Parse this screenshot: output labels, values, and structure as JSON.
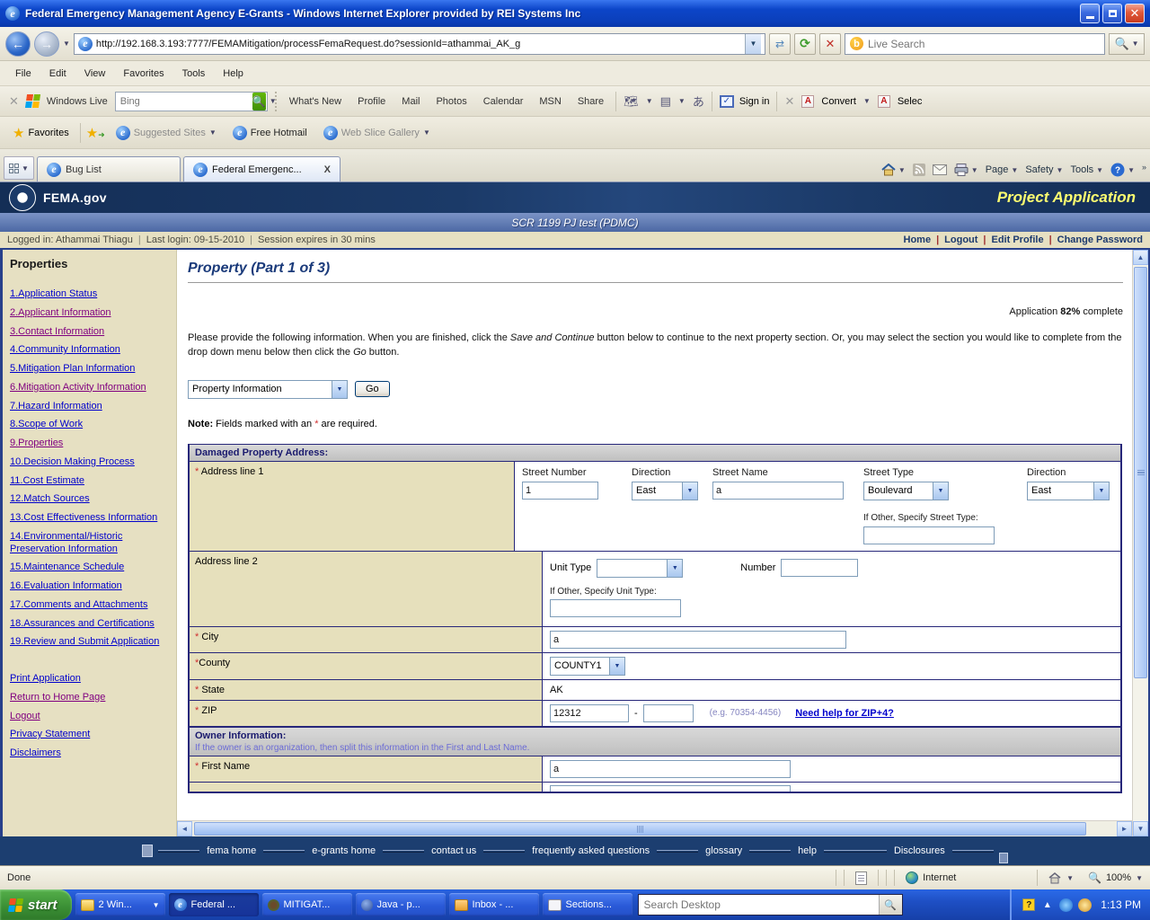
{
  "theme": {
    "accent-navy": "#1c3a6e",
    "tan": "#e6e0c2",
    "link-blue": "#0000cc",
    "visited-purple": "#800080",
    "required-red": "#d03030",
    "footer-navy": "#1c3e70",
    "taskbar-blue": "#1e4fc4",
    "start-green": "#3a8e34"
  },
  "window": {
    "title": "Federal Emergency Management Agency E-Grants - Windows Internet Explorer provided by REI Systems Inc"
  },
  "address_bar": {
    "url": "http://192.168.3.193:7777/FEMAMitigation/processFemaRequest.do?sessionId=athammai_AK_g",
    "live_search_placeholder": "Live Search"
  },
  "menu_bar": {
    "items": [
      "File",
      "Edit",
      "View",
      "Favorites",
      "Tools",
      "Help"
    ]
  },
  "live_toolbar": {
    "brand": "Windows Live",
    "bing_placeholder": "Bing",
    "links": [
      "What's New",
      "Profile",
      "Mail",
      "Photos",
      "Calendar",
      "MSN",
      "Share"
    ],
    "sign_in": "Sign in",
    "convert": "Convert",
    "select": "Selec"
  },
  "favorites_bar": {
    "favorites_label": "Favorites",
    "items": [
      "Suggested Sites",
      "Free Hotmail",
      "Web Slice Gallery"
    ]
  },
  "tab_bar": {
    "tabs": [
      {
        "label": "Bug List"
      },
      {
        "label": "Federal Emergenc...",
        "close": "X",
        "active": true
      }
    ],
    "commands": [
      "Page",
      "Safety",
      "Tools"
    ],
    "overflow": "»"
  },
  "fema_header": {
    "brand": "FEMA.gov",
    "page_title": "Project Application",
    "subtitle": "SCR 1199 PJ test (PDMC)"
  },
  "session_bar": {
    "logged_in": "Logged in: Athammai Thiagu",
    "last_login": "Last login: 09-15-2010",
    "expires": "Session expires in 30 mins",
    "links": [
      "Home",
      "Logout",
      "Edit Profile",
      "Change Password"
    ]
  },
  "sidebar": {
    "title": "Properties",
    "items": [
      {
        "label": "1.Application Status",
        "visited": false
      },
      {
        "label": "2.Applicant Information",
        "visited": true
      },
      {
        "label": "3.Contact Information",
        "visited": true
      },
      {
        "label": "4.Community Information",
        "visited": false
      },
      {
        "label": "5.Mitigation Plan Information",
        "visited": false
      },
      {
        "label": "6.Mitigation Activity Information",
        "visited": true
      },
      {
        "label": "7.Hazard Information",
        "visited": false
      },
      {
        "label": "8.Scope of Work",
        "visited": false
      },
      {
        "label": "9.Properties",
        "visited": true
      },
      {
        "label": "10.Decision Making Process",
        "visited": false
      },
      {
        "label": "11.Cost Estimate",
        "visited": false
      },
      {
        "label": "12.Match Sources",
        "visited": false
      },
      {
        "label": "13.Cost Effectiveness Information",
        "visited": false
      },
      {
        "label": "14.Environmental/Historic Preservation Information",
        "visited": false
      },
      {
        "label": "15.Maintenance Schedule",
        "visited": false
      },
      {
        "label": "16.Evaluation Information",
        "visited": false
      },
      {
        "label": "17.Comments and Attachments",
        "visited": false
      },
      {
        "label": "18.Assurances and Certifications",
        "visited": false
      },
      {
        "label": "19.Review and Submit Application",
        "visited": false
      }
    ],
    "extra_links": [
      {
        "label": "Print Application",
        "visited": false
      },
      {
        "label": "Return to Home Page",
        "visited": true
      },
      {
        "label": "Logout",
        "visited": true
      },
      {
        "label": "Privacy Statement",
        "visited": false
      },
      {
        "label": "Disclaimers",
        "visited": false
      }
    ]
  },
  "main": {
    "heading": "Property (Part 1 of 3)",
    "progress": {
      "prefix": "Application ",
      "percent": "82%",
      "suffix": " complete"
    },
    "intro": {
      "part1": "Please provide the following information. When you are finished, click the ",
      "em1": "Save and Continue",
      "part2": " button below to continue to the next property section. Or, you may select the section you would like to complete from the drop down menu below then click the ",
      "em2": "Go",
      "part3": " button."
    },
    "jump": {
      "selected": "Property Information",
      "go": "Go"
    },
    "note": {
      "label": "Note:",
      "before_star": " Fields marked with an ",
      "star": "*",
      "after_star": " are required."
    },
    "form": {
      "damaged_header": "Damaged Property Address:",
      "address1": {
        "label": "Address line 1",
        "required": "*",
        "street_number_label": "Street Number",
        "street_number": "1",
        "direction1_label": "Direction",
        "direction1": "East",
        "street_name_label": "Street Name",
        "street_name": "a",
        "street_type_label": "Street Type",
        "street_type": "Boulevard",
        "direction2_label": "Direction",
        "direction2": "East",
        "other_street_label": "If Other, Specify Street Type:",
        "other_street": ""
      },
      "address2": {
        "label": "Address line 2",
        "unit_type_label": "Unit Type",
        "unit_type": "",
        "number_label": "Number",
        "number": "",
        "other_unit_label": "If Other, Specify Unit Type:",
        "other_unit": ""
      },
      "city": {
        "label": "City",
        "required": "*",
        "value": "a"
      },
      "county": {
        "label": "County",
        "required": "*",
        "value": "COUNTY1"
      },
      "state": {
        "label": "State",
        "required": "*",
        "value": "AK"
      },
      "zip": {
        "label": "ZIP",
        "required": "*",
        "value": "12312",
        "plus4": "",
        "dash": "-",
        "hint": "(e.g. 70354-4456)",
        "help_link": "Need help for ZIP+4?"
      },
      "owner_header": {
        "title": "Owner Information:",
        "note": "If the owner is an organization, then split this information in the First and Last Name."
      },
      "first_name": {
        "label": "First Name",
        "required": "*",
        "value": "a"
      }
    }
  },
  "footer": {
    "links": [
      "fema home",
      "e-grants home",
      "contact us",
      "frequently asked questions",
      "glossary",
      "help",
      "Disclosures"
    ]
  },
  "status_bar": {
    "done": "Done",
    "zone": "Internet",
    "zoom": "100%"
  },
  "taskbar": {
    "start": "start",
    "items": [
      {
        "label": "2 Win...",
        "grouped": true
      },
      {
        "label": "Federal ...",
        "active": true
      },
      {
        "label": "MITIGAT..."
      },
      {
        "label": "Java - p..."
      },
      {
        "label": "Inbox - ..."
      },
      {
        "label": "Sections..."
      }
    ],
    "search_placeholder": "Search Desktop",
    "time": "1:13 PM"
  }
}
